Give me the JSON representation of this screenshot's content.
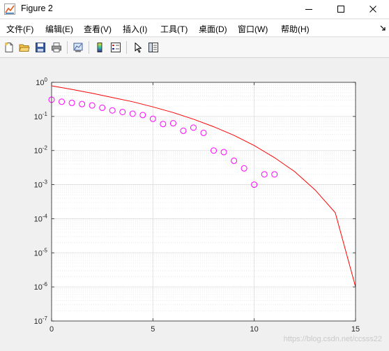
{
  "window": {
    "title": "Figure 2",
    "icon": "matlab-figure-icon",
    "controls": [
      "minimize-icon",
      "maximize-icon",
      "close-icon"
    ]
  },
  "menu": {
    "items": [
      "文件(F)",
      "编辑(E)",
      "查看(V)",
      "插入(I)",
      "工具(T)",
      "桌面(D)",
      "窗口(W)",
      "帮助(H)"
    ],
    "overflow_icon": "dock-arrow-icon"
  },
  "toolbar": {
    "buttons": [
      "new-figure-icon",
      "open-file-icon",
      "save-icon",
      "print-icon",
      "link-plot-icon",
      "insert-colorbar-icon",
      "insert-legend-icon",
      "edit-plot-icon",
      "property-editor-icon"
    ]
  },
  "colors": {
    "curve": "#ff0000",
    "markers": "#ff00ff",
    "background": "#f0f0f0",
    "axes_background": "#ffffff"
  },
  "chart_data": {
    "type": "scatter",
    "title": "",
    "xlabel": "",
    "ylabel": "",
    "xlim": [
      0,
      15
    ],
    "ylim": [
      1e-07,
      1
    ],
    "yscale": "log",
    "grid": "on (major and minor)",
    "xticks": [
      0,
      5,
      10,
      15
    ],
    "xtick_labels": [
      "0",
      "5",
      "10",
      "15"
    ],
    "yticks": [
      1e-07,
      1e-06,
      1e-05,
      0.0001,
      0.001,
      0.01,
      0.1,
      1
    ],
    "ytick_labels": [
      {
        "base": "10",
        "exp": "-7"
      },
      {
        "base": "10",
        "exp": "-6"
      },
      {
        "base": "10",
        "exp": "-5"
      },
      {
        "base": "10",
        "exp": "-4"
      },
      {
        "base": "10",
        "exp": "-3"
      },
      {
        "base": "10",
        "exp": "-2"
      },
      {
        "base": "10",
        "exp": "-1"
      },
      {
        "base": "10",
        "exp": "0"
      }
    ],
    "series": [
      {
        "marker": "circle",
        "color": "#ff00ff",
        "x": [
          0,
          0.5,
          1,
          1.5,
          2,
          2.5,
          3,
          3.5,
          4,
          4.5,
          5,
          5.5,
          6,
          6.5,
          7,
          7.5,
          8,
          8.5,
          9,
          9.5,
          10,
          10.5,
          11
        ],
        "y": [
          0.31,
          0.27,
          0.25,
          0.23,
          0.21,
          0.18,
          0.15,
          0.135,
          0.12,
          0.11,
          0.085,
          0.06,
          0.063,
          0.038,
          0.047,
          0.033,
          0.01,
          0.009,
          0.005,
          0.003,
          0.001,
          0.002,
          0.002
        ]
      },
      {
        "line": "solid",
        "color": "#ff0000",
        "x": [
          0,
          1,
          2,
          3,
          4,
          5,
          6,
          7,
          8,
          9,
          10,
          11,
          12,
          13,
          14,
          15
        ],
        "y": [
          0.79,
          0.62,
          0.48,
          0.36,
          0.27,
          0.19,
          0.13,
          0.083,
          0.05,
          0.028,
          0.014,
          0.0062,
          0.0024,
          0.0007,
          0.00015,
          1e-06
        ]
      }
    ]
  },
  "watermark": "https://blog.csdn.net/ccsss22"
}
